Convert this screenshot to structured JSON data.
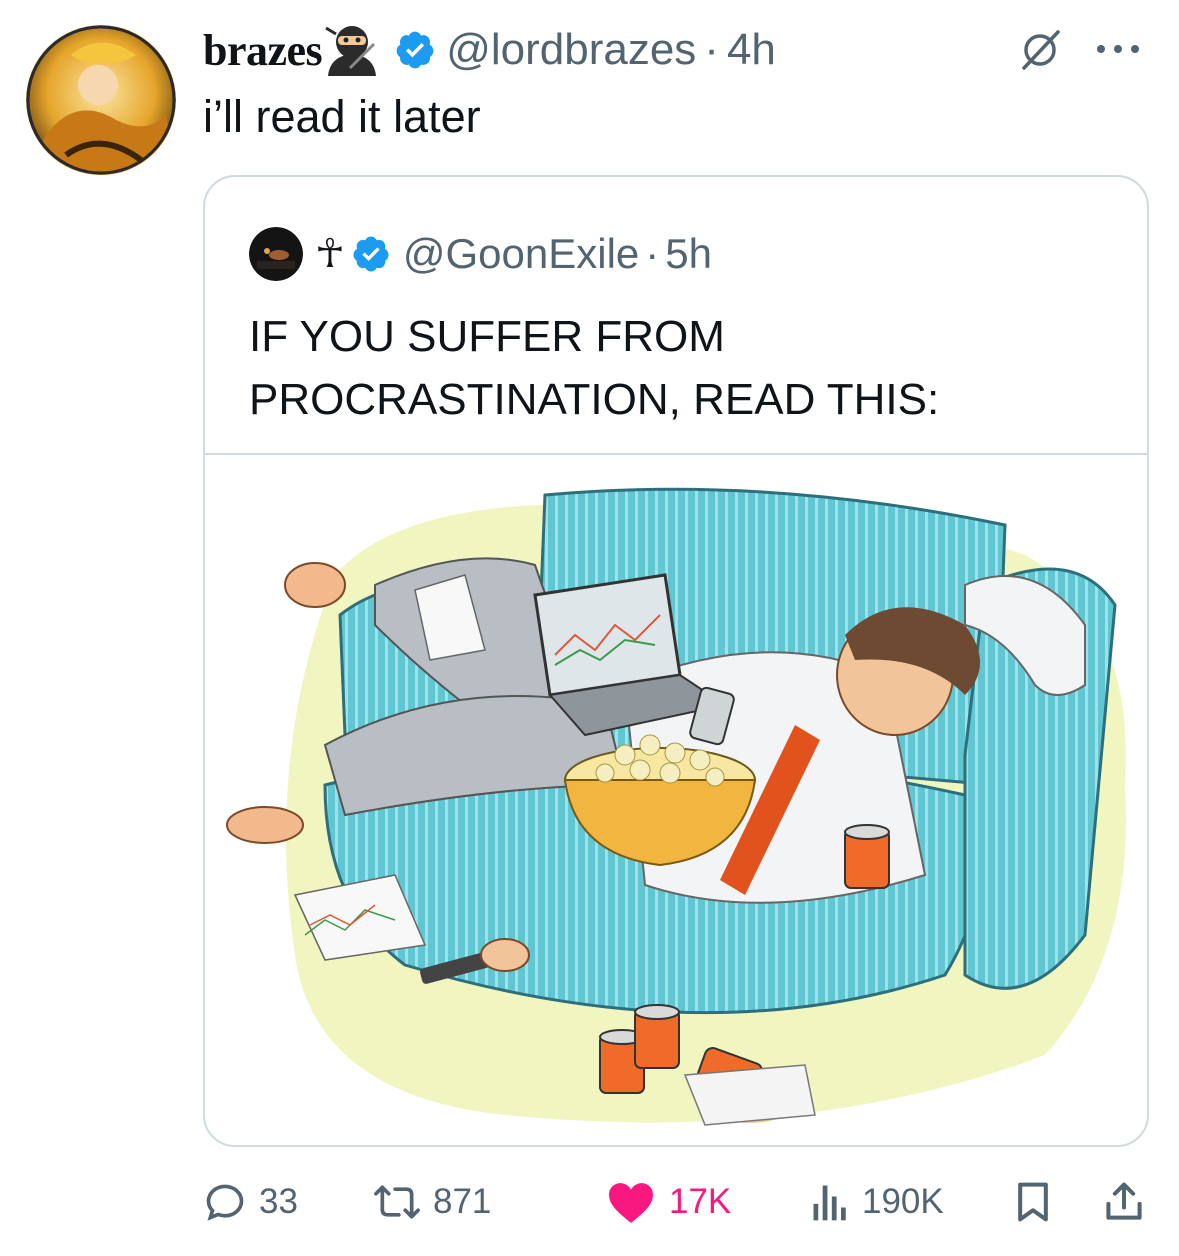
{
  "post": {
    "display_name": "brazes",
    "handle": "@lordbrazes",
    "separator": "·",
    "time": "4h",
    "text": "i’ll read it later",
    "icons": [
      "ninja-emoji-icon",
      "verified-badge-icon",
      "grok-icon",
      "more-icon"
    ]
  },
  "quote": {
    "display_name": "☥",
    "handle": "@GoonExile",
    "separator": "·",
    "time": "5h",
    "text": "IF YOU SUFFER FROM PROCRASTINATION, READ THIS:",
    "media": "illustration of a man lounging on a striped blue couch with laptop, popcorn and soda cans"
  },
  "actions": {
    "replies": "33",
    "reposts": "871",
    "likes": "17K",
    "views": "190K"
  },
  "colors": {
    "text": "#0f1419",
    "secondary": "#536471",
    "verified": "#1d9bf0",
    "like": "#f91880",
    "border": "#cfd9de"
  }
}
